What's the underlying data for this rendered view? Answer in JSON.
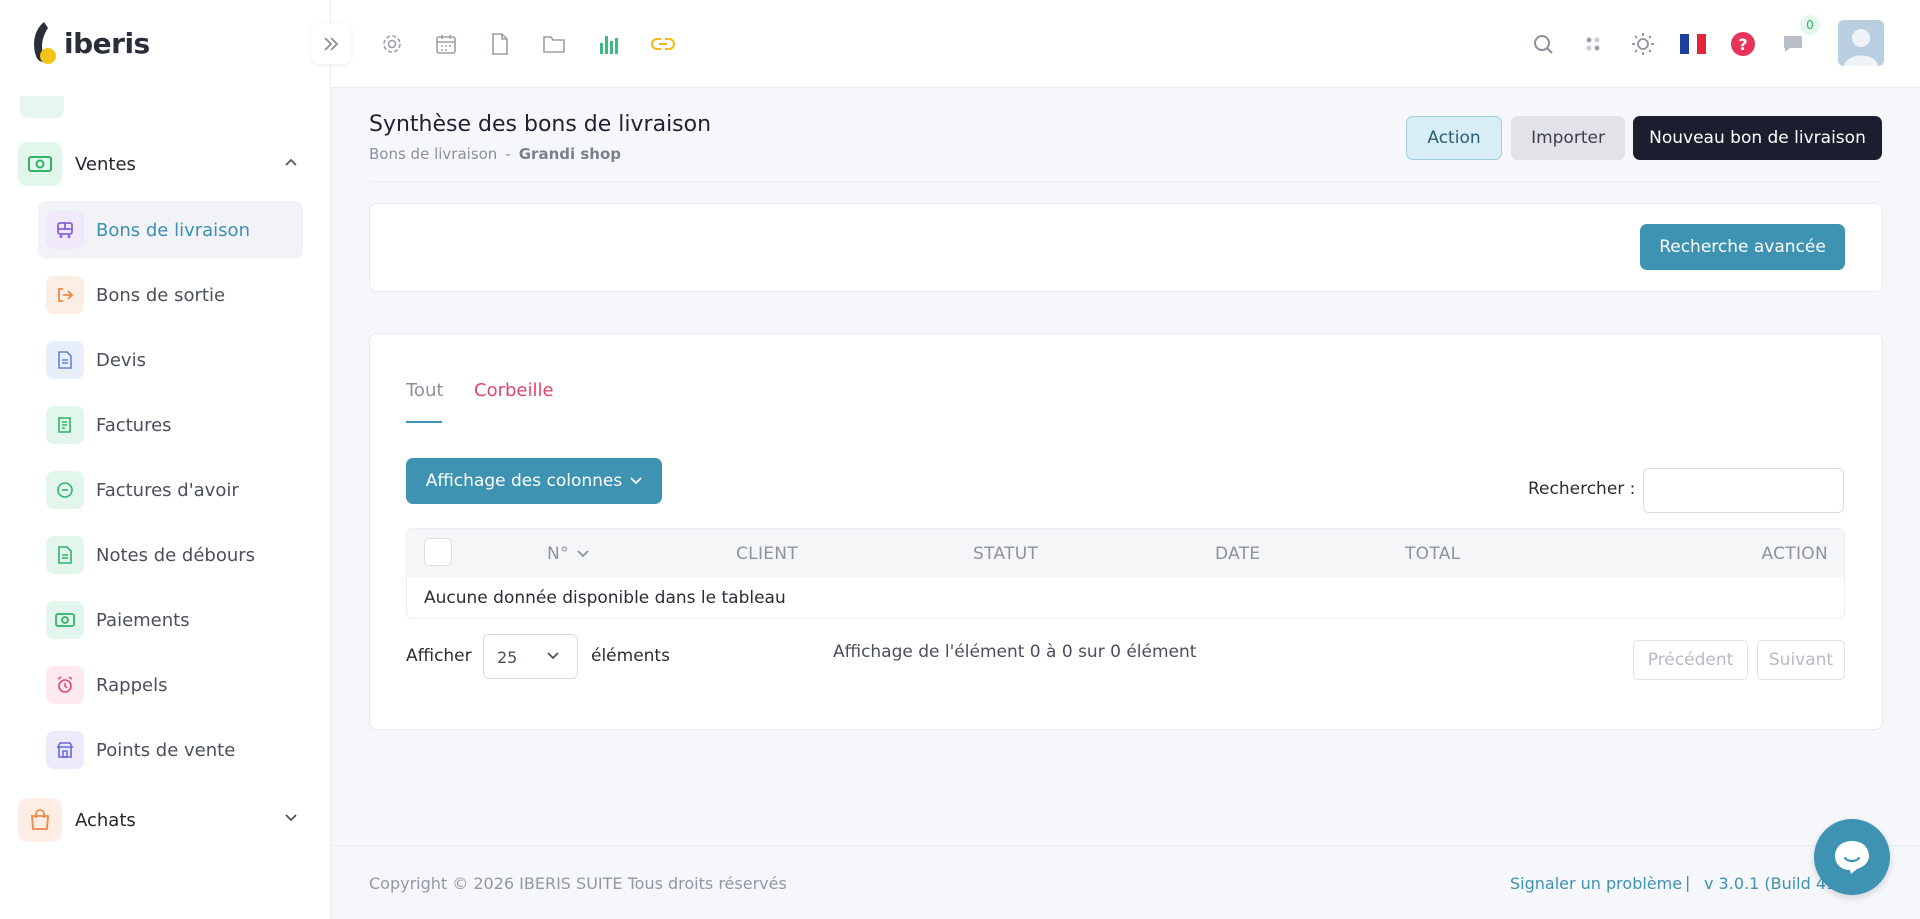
{
  "app": {
    "name": "iberis"
  },
  "colors": {
    "primary": "#3e92b2",
    "dark": "#1a1e2e",
    "danger": "#e0466b",
    "success": "#2fb36a"
  },
  "sidebar": {
    "sections": [
      {
        "label": "Ventes",
        "icon": "money-icon",
        "expanded": true
      },
      {
        "label": "Achats",
        "icon": "shopping-bag-icon",
        "expanded": false
      }
    ],
    "items": [
      {
        "label": "Bons de livraison",
        "icon": "truck-icon",
        "active": true
      },
      {
        "label": "Bons de sortie",
        "icon": "exit-icon"
      },
      {
        "label": "Devis",
        "icon": "document-icon"
      },
      {
        "label": "Factures",
        "icon": "invoice-icon"
      },
      {
        "label": "Factures d'avoir",
        "icon": "minus-circle-icon"
      },
      {
        "label": "Notes de débours",
        "icon": "note-icon"
      },
      {
        "label": "Paiements",
        "icon": "money-icon"
      },
      {
        "label": "Rappels",
        "icon": "alarm-icon"
      },
      {
        "label": "Points de vente",
        "icon": "store-icon"
      }
    ]
  },
  "topbar": {
    "icons": [
      "settings-icon",
      "calendar-icon",
      "file-icon",
      "folder-icon",
      "bar-chart-icon",
      "link-icon"
    ],
    "right_icons": [
      "search-icon",
      "apps-icon",
      "theme-icon",
      "flag-fr-icon",
      "help-icon",
      "chat-icon"
    ],
    "notification_count": "0"
  },
  "header": {
    "title": "Synthèse des bons de livraison",
    "breadcrumb": [
      "Bons de livraison",
      "Grandi shop"
    ],
    "breadcrumb_sep": "-",
    "buttons": {
      "action": "Action",
      "import": "Importer",
      "new": "Nouveau bon de livraison"
    }
  },
  "filters": {
    "advanced_search": "Recherche avancée"
  },
  "tabs": [
    {
      "label": "Tout",
      "active": true
    },
    {
      "label": "Corbeille",
      "active": false
    }
  ],
  "table": {
    "columns_button": "Affichage des colonnes",
    "search_label": "Rechercher :",
    "search_value": "",
    "headers": [
      "N°",
      "CLIENT",
      "STATUT",
      "DATE",
      "TOTAL",
      "ACTION"
    ],
    "empty_message": "Aucune donnée disponible dans le tableau",
    "show_label": "Afficher",
    "page_size": "25",
    "elements_label": "éléments",
    "info": "Affichage de l'élément 0 à 0 sur 0 élément",
    "prev": "Précédent",
    "next": "Suivant"
  },
  "footer": {
    "copyright": "Copyright © 2026 IBERIS SUITE Tous droits réservés",
    "report": "Signaler un problème",
    "separator": "|",
    "version": "v 3.0.1 (Build 414"
  }
}
